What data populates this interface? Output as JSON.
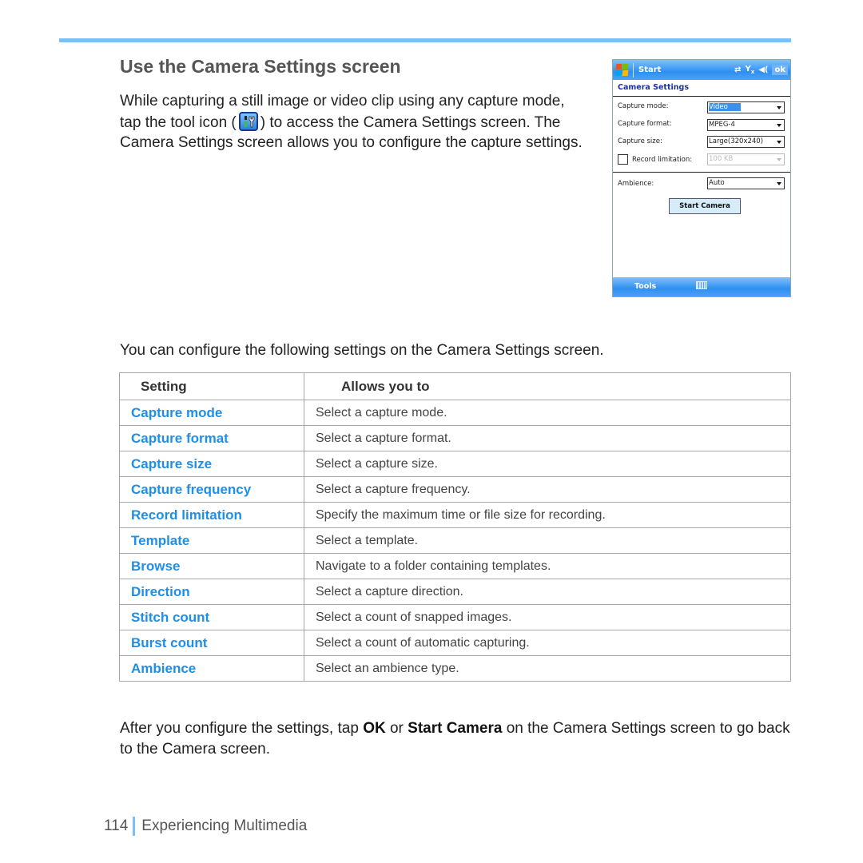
{
  "page": {
    "title": "Use the Camera Settings screen",
    "intro_before_icon": "While capturing a still image or video clip using any capture mode, tap the tool icon (",
    "intro_after_icon": ") to access the Camera Settings screen. The Camera Settings screen allows you to configure the capture settings.",
    "intro_icon": "tool-icon",
    "lead": "You can configure the following settings on the Camera Settings screen.",
    "outro_part1": "After you configure the settings, tap ",
    "outro_bold1": "OK",
    "outro_part2": " or ",
    "outro_bold2": "Start Camera",
    "outro_part3": " on the Camera Settings screen to go back to the Camera screen.",
    "page_number": "114",
    "section_name": "Experiencing Multimedia",
    "accent_color": "#7fbff8",
    "link_color": "#1e8fe8"
  },
  "phone": {
    "start_label": "Start",
    "ok_label": "ok",
    "status_icons": [
      "sync-icon",
      "signal-off-icon",
      "speaker-icon"
    ],
    "heading": "Camera Settings",
    "fields": [
      {
        "label": "Capture mode:",
        "value": "Video",
        "selected": true
      },
      {
        "label": "Capture format:",
        "value": "MPEG-4"
      },
      {
        "label": "Capture size:",
        "value": "Large(320x240)"
      },
      {
        "label": "Record limitation:",
        "value": "100 KB",
        "disabled": true,
        "checked": false
      },
      {
        "label": "Ambience:",
        "value": "Auto"
      }
    ],
    "start_button": "Start Camera",
    "menu_left": "Tools"
  },
  "table": {
    "headers": [
      "Setting",
      "Allows you to"
    ],
    "rows": [
      {
        "setting": "Capture mode",
        "desc": "Select a capture mode."
      },
      {
        "setting": "Capture format",
        "desc": "Select a capture format."
      },
      {
        "setting": "Capture size",
        "desc": "Select a capture size."
      },
      {
        "setting": "Capture frequency",
        "desc": "Select a capture frequency."
      },
      {
        "setting": "Record limitation",
        "desc": "Specify the maximum time or file size for recording."
      },
      {
        "setting": "Template",
        "desc": "Select a template."
      },
      {
        "setting": "Browse",
        "desc": "Navigate to a folder containing templates."
      },
      {
        "setting": "Direction",
        "desc": "Select a capture direction."
      },
      {
        "setting": "Stitch count",
        "desc": "Select a count of snapped images."
      },
      {
        "setting": "Burst count",
        "desc": "Select a count of automatic capturing."
      },
      {
        "setting": "Ambience",
        "desc": "Select an ambience type."
      }
    ]
  }
}
